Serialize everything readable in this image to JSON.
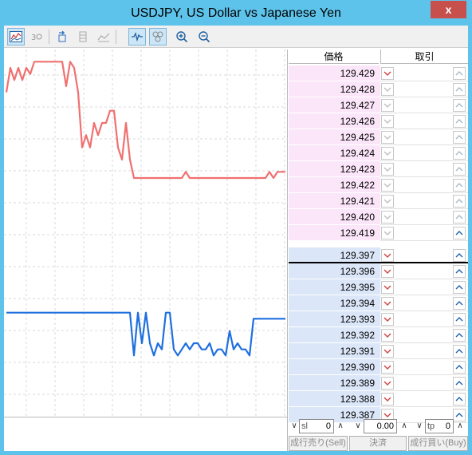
{
  "window": {
    "title": "USDJPY, US Dollar vs Japanese Yen",
    "close_label": "x"
  },
  "toolbar": {
    "icons": [
      "chart-mode-icon",
      "indicator-icon",
      "auto-scroll-icon",
      "chart-shift-icon",
      "grid-toggle-icon",
      "tick-chart-icon",
      "depth-icon",
      "zoom-in-icon",
      "zoom-out-icon"
    ]
  },
  "ladder": {
    "header_price": "価格",
    "header_trade": "取引",
    "asks": [
      "129.429",
      "129.428",
      "129.427",
      "129.426",
      "129.425",
      "129.424",
      "129.423",
      "129.422",
      "129.421",
      "129.420",
      "129.419"
    ],
    "bids": [
      "129.397",
      "129.396",
      "129.395",
      "129.394",
      "129.393",
      "129.392",
      "129.391",
      "129.390",
      "129.389",
      "129.388",
      "129.387"
    ]
  },
  "order": {
    "sl_label": "sl",
    "sl_value": "0",
    "volume_value": "0.00",
    "tp_label": "tp",
    "tp_value": "0",
    "sell_label": "成行売り(Sell)",
    "close_label": "決済",
    "buy_label": "成行買い(Buy)"
  },
  "chart_data": {
    "type": "line",
    "ylim": [
      129.38,
      129.44
    ],
    "grid": true,
    "series": [
      {
        "color": "#f07070",
        "values": [
          129.433,
          129.437,
          129.435,
          129.437,
          129.435,
          129.437,
          129.436,
          129.438,
          129.438,
          129.438,
          129.438,
          129.438,
          129.438,
          129.438,
          129.438,
          129.434,
          129.438,
          129.437,
          129.433,
          129.424,
          129.426,
          129.424,
          129.428,
          129.426,
          129.428,
          129.428,
          129.43,
          129.43,
          129.424,
          129.422,
          129.428,
          129.422,
          129.419,
          129.419,
          129.419,
          129.419,
          129.419,
          129.419,
          129.419,
          129.419,
          129.419,
          129.419,
          129.419,
          129.419,
          129.419,
          129.42,
          129.419,
          129.419,
          129.419,
          129.419,
          129.419,
          129.419,
          129.419,
          129.419,
          129.419,
          129.419,
          129.419,
          129.419,
          129.419,
          129.419,
          129.419,
          129.419,
          129.419,
          129.419,
          129.419,
          129.419,
          129.42,
          129.419,
          129.42,
          129.42,
          129.42
        ]
      },
      {
        "color": "#1e6fe0",
        "values": [
          129.397,
          129.397,
          129.397,
          129.397,
          129.397,
          129.397,
          129.397,
          129.397,
          129.397,
          129.397,
          129.397,
          129.397,
          129.397,
          129.397,
          129.397,
          129.397,
          129.397,
          129.397,
          129.397,
          129.397,
          129.397,
          129.397,
          129.397,
          129.397,
          129.397,
          129.397,
          129.397,
          129.397,
          129.397,
          129.397,
          129.397,
          129.397,
          129.39,
          129.397,
          129.392,
          129.397,
          129.392,
          129.39,
          129.392,
          129.391,
          129.397,
          129.397,
          129.391,
          129.39,
          129.391,
          129.392,
          129.391,
          129.392,
          129.392,
          129.391,
          129.391,
          129.392,
          129.39,
          129.391,
          129.391,
          129.39,
          129.394,
          129.391,
          129.392,
          129.391,
          129.391,
          129.39,
          129.396,
          129.396,
          129.396,
          129.396,
          129.396,
          129.396,
          129.396,
          129.396,
          129.396
        ]
      }
    ]
  }
}
